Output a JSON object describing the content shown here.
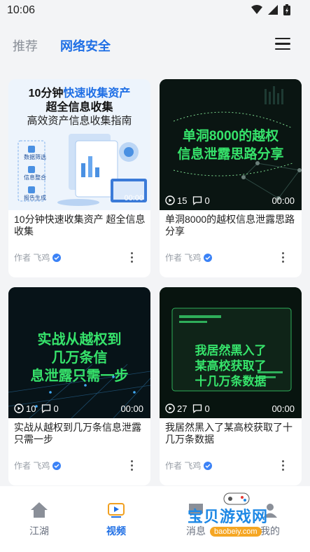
{
  "status_bar": {
    "time": "10:06",
    "icons": [
      "wifi-icon",
      "signal-icon",
      "battery-icon"
    ]
  },
  "top_tabs": {
    "items": [
      "推荐",
      "网络安全"
    ],
    "active": "网络安全"
  },
  "cards": [
    {
      "title": "10分钟快速收集资产  超全信息收集",
      "author": "作者 飞鸡",
      "thumb": {
        "headline_a": "10分钟",
        "headline_b": "快速收集资产",
        "headline_c": "超全信息收集",
        "subtitle": "高效资产信息收集指南",
        "labels": [
          "数据筛选",
          "信息整合",
          "报告生成"
        ],
        "duration": "00:00"
      }
    },
    {
      "title": "单洞8000的越权信息泄露思路分享",
      "author": "作者 飞鸡",
      "thumb": {
        "lines": [
          "单洞8000的越权",
          "信息泄露思路分享"
        ],
        "plays": "15",
        "comments": "0",
        "duration": "00:00"
      }
    },
    {
      "title": "实战从越权到几万条信息泄露只需一步",
      "author": "作者 飞鸡",
      "thumb": {
        "lines": [
          "实战从越权到",
          "几万条信",
          "息泄露只需一步"
        ],
        "plays": "10",
        "comments": "0",
        "duration": "00:00"
      }
    },
    {
      "title": "我居然黑入了某高校获取了十几万条数据",
      "author": "作者 飞鸡",
      "thumb": {
        "lines": [
          "我居然黑入了",
          "某高校获取了",
          "十几万条数据"
        ],
        "plays": "27",
        "comments": "0",
        "duration": "00:00"
      }
    }
  ],
  "bottom_nav": {
    "items": [
      {
        "label": "江湖",
        "icon": "house-icon"
      },
      {
        "label": "视频",
        "icon": "video-icon"
      },
      {
        "label": "消息",
        "icon": "message-icon"
      },
      {
        "label": "我的",
        "icon": "profile-icon"
      }
    ],
    "active": "视频"
  },
  "watermark": {
    "text": "宝贝游戏网",
    "url": "baobeiy.com"
  },
  "colors": {
    "accent": "#1f6fe5",
    "neon": "#36e36b",
    "background": "#f3f4f6"
  }
}
